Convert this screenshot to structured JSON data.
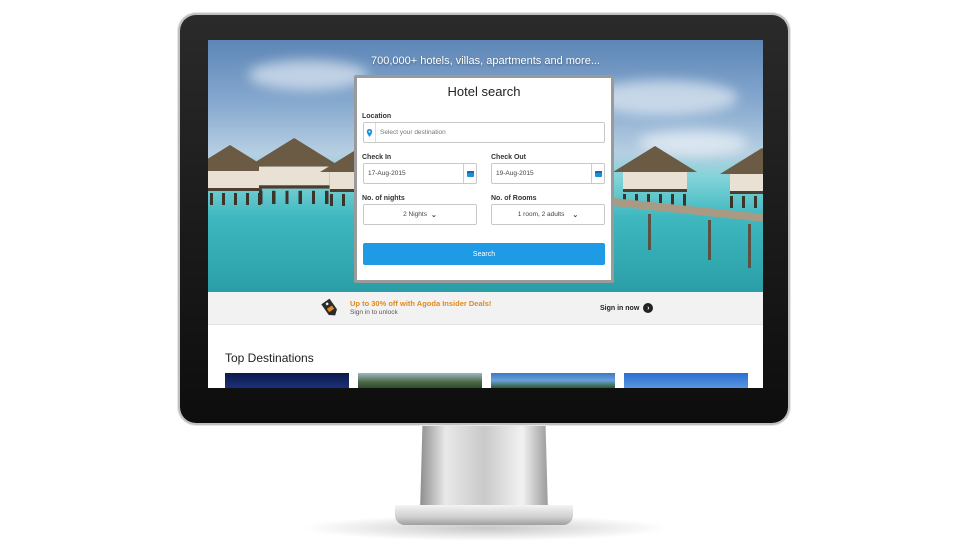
{
  "hero": {
    "tagline": "700,000+ hotels, villas, apartments and more..."
  },
  "search_card": {
    "title": "Hotel search",
    "location": {
      "label": "Location",
      "placeholder": "Select your destination",
      "icon": "map-pin-icon"
    },
    "check_in": {
      "label": "Check In",
      "value": "17-Aug-2015",
      "icon": "calendar-icon"
    },
    "check_out": {
      "label": "Check Out",
      "value": "19-Aug-2015",
      "icon": "calendar-icon"
    },
    "nights": {
      "label": "No. of nights",
      "value": "2 Nights"
    },
    "rooms": {
      "label": "No. of Rooms",
      "value": "1 room, 2 adults"
    },
    "search_button": "Search"
  },
  "promo": {
    "title": "Up to 30% off with Agoda Insider Deals!",
    "subtitle": "Sign in to unlock",
    "signin_label": "Sign in now",
    "icon": "price-tag-icon",
    "accent_color": "#e08a1e"
  },
  "destinations": {
    "title": "Top Destinations"
  },
  "colors": {
    "primary_button": "#1e9be4",
    "bezel": "#111111"
  }
}
